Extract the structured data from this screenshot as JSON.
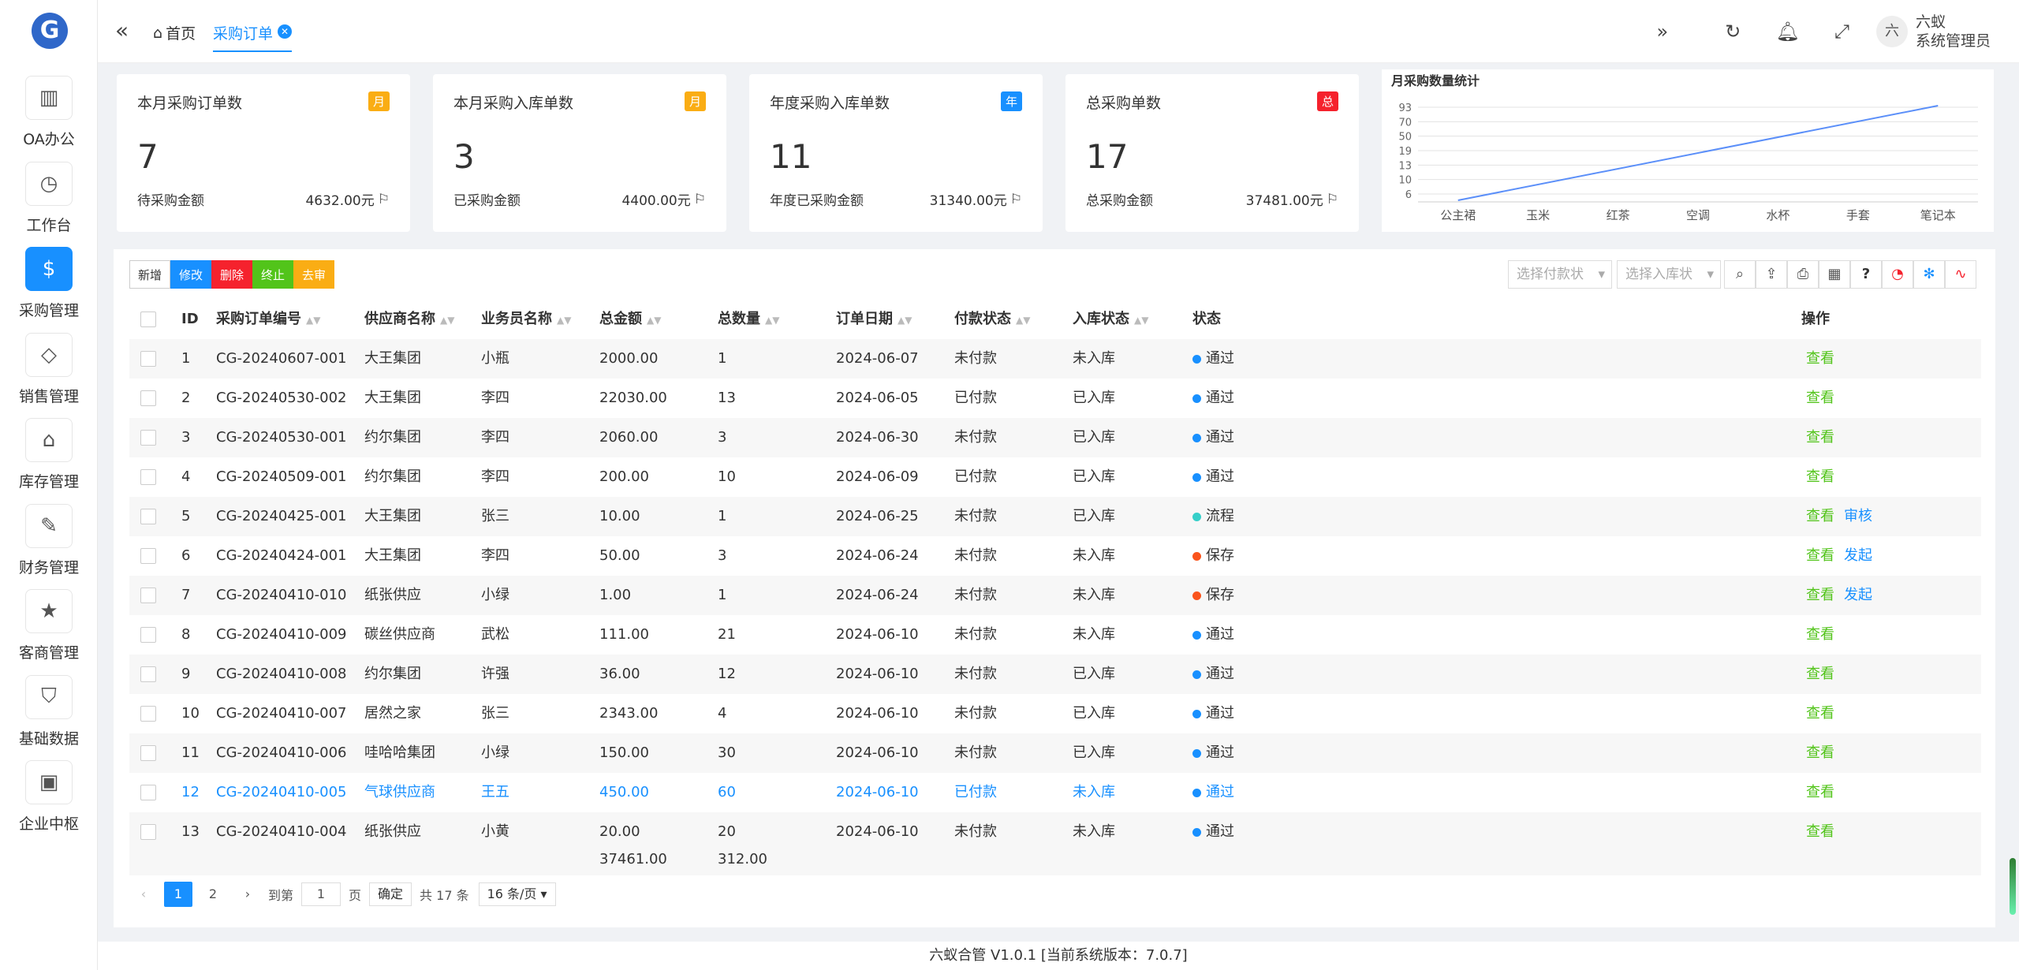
{
  "sidebar": {
    "logo": "G",
    "items": [
      {
        "label": "OA办公",
        "icon": "book-icon"
      },
      {
        "label": "工作台",
        "icon": "dashboard-icon"
      },
      {
        "label": "采购管理",
        "icon": "dollar-icon"
      },
      {
        "label": "销售管理",
        "icon": "diamond-icon"
      },
      {
        "label": "库存管理",
        "icon": "home-icon"
      },
      {
        "label": "财务管理",
        "icon": "edit-doc-icon"
      },
      {
        "label": "客商管理",
        "icon": "star-icon"
      },
      {
        "label": "基础数据",
        "icon": "shield-icon"
      },
      {
        "label": "企业中枢",
        "icon": "apps-icon"
      }
    ],
    "active_index": 2
  },
  "header": {
    "home": "首页",
    "active_tab": "采购订单",
    "avatar_text": "六",
    "user_line1": "六蚁",
    "user_line2": "系统管理员"
  },
  "stats": [
    {
      "title": "本月采购订单数",
      "badge": "月",
      "badge_color": "#faad14",
      "value": "7",
      "sub_label": "待采购金额",
      "sub_value": "4632.00元"
    },
    {
      "title": "本月采购入库单数",
      "badge": "月",
      "badge_color": "#faad14",
      "value": "3",
      "sub_label": "已采购金额",
      "sub_value": "4400.00元"
    },
    {
      "title": "年度采购入库单数",
      "badge": "年",
      "badge_color": "#1890ff",
      "value": "11",
      "sub_label": "年度已采购金额",
      "sub_value": "31340.00元"
    },
    {
      "title": "总采购单数",
      "badge": "总",
      "badge_color": "#f5222d",
      "value": "17",
      "sub_label": "总采购金额",
      "sub_value": "37481.00元"
    }
  ],
  "chart_data": {
    "type": "line",
    "title": "月采购数量统计",
    "categories": [
      "公主裙",
      "玉米",
      "红茶",
      "空调",
      "水杯",
      "手套",
      "笔记本"
    ],
    "y_ticks": [
      6,
      10,
      13,
      19,
      50,
      70,
      93
    ],
    "series": [
      {
        "values": [
          6,
          10,
          13,
          19,
          50,
          70,
          93
        ]
      }
    ],
    "color": "#5b8ff9"
  },
  "toolbar": {
    "add": "新增",
    "edit": "修改",
    "delete": "删除",
    "stop": "终止",
    "unaudit": "去审",
    "pay_filter": "选择付款状",
    "stock_filter": "选择入库状"
  },
  "table": {
    "headers": {
      "id": "ID",
      "code": "采购订单编号",
      "supplier": "供应商名称",
      "clerk": "业务员名称",
      "amount": "总金额",
      "qty": "总数量",
      "date": "订单日期",
      "pay": "付款状态",
      "stock": "入库状态",
      "status": "状态",
      "ops": "操作"
    },
    "rows": [
      {
        "id": "1",
        "code": "CG-20240607-001",
        "supplier": "大王集团",
        "clerk": "小瓶",
        "amount": "2000.00",
        "qty": "1",
        "date": "2024-06-07",
        "pay": "未付款",
        "stock": "未入库",
        "status": "通过",
        "status_color": "#1890ff",
        "op1": "查看",
        "op2": ""
      },
      {
        "id": "2",
        "code": "CG-20240530-002",
        "supplier": "大王集团",
        "clerk": "李四",
        "amount": "22030.00",
        "qty": "13",
        "date": "2024-06-05",
        "pay": "已付款",
        "stock": "已入库",
        "status": "通过",
        "status_color": "#1890ff",
        "op1": "查看",
        "op2": ""
      },
      {
        "id": "3",
        "code": "CG-20240530-001",
        "supplier": "约尔集团",
        "clerk": "李四",
        "amount": "2060.00",
        "qty": "3",
        "date": "2024-06-30",
        "pay": "未付款",
        "stock": "已入库",
        "status": "通过",
        "status_color": "#1890ff",
        "op1": "查看",
        "op2": ""
      },
      {
        "id": "4",
        "code": "CG-20240509-001",
        "supplier": "约尔集团",
        "clerk": "李四",
        "amount": "200.00",
        "qty": "10",
        "date": "2024-06-09",
        "pay": "已付款",
        "stock": "已入库",
        "status": "通过",
        "status_color": "#1890ff",
        "op1": "查看",
        "op2": ""
      },
      {
        "id": "5",
        "code": "CG-20240425-001",
        "supplier": "大王集团",
        "clerk": "张三",
        "amount": "10.00",
        "qty": "1",
        "date": "2024-06-25",
        "pay": "未付款",
        "stock": "已入库",
        "status": "流程",
        "status_color": "#36cfc9",
        "op1": "查看",
        "op2": "审核"
      },
      {
        "id": "6",
        "code": "CG-20240424-001",
        "supplier": "大王集团",
        "clerk": "李四",
        "amount": "50.00",
        "qty": "3",
        "date": "2024-06-24",
        "pay": "未付款",
        "stock": "未入库",
        "status": "保存",
        "status_color": "#fa541c",
        "op1": "查看",
        "op2": "发起"
      },
      {
        "id": "7",
        "code": "CG-20240410-010",
        "supplier": "纸张供应",
        "clerk": "小绿",
        "amount": "1.00",
        "qty": "1",
        "date": "2024-06-24",
        "pay": "未付款",
        "stock": "未入库",
        "status": "保存",
        "status_color": "#fa541c",
        "op1": "查看",
        "op2": "发起"
      },
      {
        "id": "8",
        "code": "CG-20240410-009",
        "supplier": "碳丝供应商",
        "clerk": "武松",
        "amount": "111.00",
        "qty": "21",
        "date": "2024-06-10",
        "pay": "未付款",
        "stock": "未入库",
        "status": "通过",
        "status_color": "#1890ff",
        "op1": "查看",
        "op2": ""
      },
      {
        "id": "9",
        "code": "CG-20240410-008",
        "supplier": "约尔集团",
        "clerk": "许强",
        "amount": "36.00",
        "qty": "12",
        "date": "2024-06-10",
        "pay": "未付款",
        "stock": "已入库",
        "status": "通过",
        "status_color": "#1890ff",
        "op1": "查看",
        "op2": ""
      },
      {
        "id": "10",
        "code": "CG-20240410-007",
        "supplier": "居然之家",
        "clerk": "张三",
        "amount": "2343.00",
        "qty": "4",
        "date": "2024-06-10",
        "pay": "未付款",
        "stock": "已入库",
        "status": "通过",
        "status_color": "#1890ff",
        "op1": "查看",
        "op2": ""
      },
      {
        "id": "11",
        "code": "CG-20240410-006",
        "supplier": "哇哈哈集团",
        "clerk": "小绿",
        "amount": "150.00",
        "qty": "30",
        "date": "2024-06-10",
        "pay": "未付款",
        "stock": "已入库",
        "status": "通过",
        "status_color": "#1890ff",
        "op1": "查看",
        "op2": ""
      },
      {
        "id": "12",
        "code": "CG-20240410-005",
        "supplier": "气球供应商",
        "clerk": "王五",
        "amount": "450.00",
        "qty": "60",
        "date": "2024-06-10",
        "pay": "已付款",
        "stock": "未入库",
        "status": "通过",
        "status_color": "#1890ff",
        "op1": "查看",
        "op2": ""
      },
      {
        "id": "13",
        "code": "CG-20240410-004",
        "supplier": "纸张供应",
        "clerk": "小黄",
        "amount": "20.00",
        "qty": "20",
        "date": "2024-06-10",
        "pay": "未付款",
        "stock": "未入库",
        "status": "通过",
        "status_color": "#1890ff",
        "op1": "查看",
        "op2": ""
      }
    ],
    "highlight_index": 11,
    "total_amount": "37461.00",
    "total_qty": "312.00"
  },
  "pager": {
    "page1": "1",
    "page2": "2",
    "goto": "到第",
    "input": "1",
    "page_unit": "页",
    "confirm": "确定",
    "total": "共 17 条",
    "size": "16 条/页"
  },
  "footer": "六蚁合管 V1.0.1 [当前系统版本：7.0.7]"
}
